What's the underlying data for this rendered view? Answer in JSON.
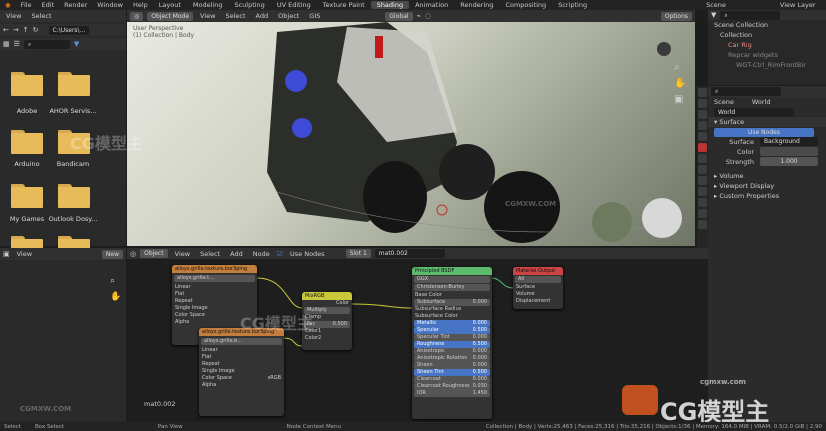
{
  "topbar": {
    "menus": [
      "File",
      "Edit",
      "Render",
      "Window",
      "Help"
    ],
    "workspaces": [
      "Layout",
      "Modeling",
      "Sculpting",
      "UV Editing",
      "Texture Paint",
      "Shading",
      "Animation",
      "Rendering",
      "Compositing",
      "Scripting"
    ],
    "active_workspace": "Shading",
    "scene_label": "Scene",
    "view_layer_label": "View Layer"
  },
  "file_browser": {
    "view_menu": "View",
    "select_menu": "Select",
    "path": "C:\\Users\\...",
    "items": [
      "Adobe",
      "AHOR Servis...",
      "Arduino",
      "Bandicam",
      "My Games",
      "Outlook Dosy..."
    ]
  },
  "viewport": {
    "mode": "Object Mode",
    "menus": [
      "View",
      "Select",
      "Add",
      "Object",
      "GIS"
    ],
    "transform": "Global",
    "options": "Options",
    "overlay_text": [
      "User Perspective",
      "(1) Collection | Body"
    ]
  },
  "outliner": {
    "title": "Scene Collection",
    "items": [
      "Collection",
      "Car Rig",
      "Repcar widgets",
      "WGT-Ctrl_RimFrontBir"
    ]
  },
  "properties": {
    "scene": "Scene",
    "world_tab": "World",
    "world_name": "World",
    "surface_header": "Surface",
    "use_nodes_btn": "Use Nodes",
    "surface_label": "Surface",
    "surface_value": "Background",
    "color_label": "Color",
    "strength_label": "Strength",
    "strength_value": "1.000",
    "sections": [
      "Volume",
      "Viewport Display",
      "Custom Properties"
    ]
  },
  "node_editor": {
    "object_select": "Object",
    "menus": [
      "View",
      "Select",
      "Add",
      "Node"
    ],
    "use_nodes": "Use Nodes",
    "slot": "Slot 1",
    "material": "mat0.002",
    "nodes": {
      "tex1": {
        "title": "alloys.grille.texture.bor3ping",
        "img": "alloys.grille.t...",
        "rows": [
          "Linear",
          "Flat",
          "Repeat",
          "Single Image",
          "Color Space",
          "Alpha"
        ]
      },
      "tex2": {
        "title": "alloys.grille.texture.bor3ping",
        "img": "alloys.grille.b...",
        "rows": [
          "Linear",
          "Flat",
          "Repeat",
          "Single Image",
          "Color Space",
          "Alpha"
        ],
        "space": "sRGB"
      },
      "mix": {
        "title": "MixRGB",
        "rows": [
          "Color",
          "Multiply",
          "Clamp",
          "Fac",
          "Color1",
          "Color2"
        ],
        "fac": "0.500"
      },
      "bsdf": {
        "title": "Principled BSDF",
        "rows": [
          "GGX",
          "Christensen-Burley",
          "Base Color",
          "Subsurface",
          "Subsurface Radius",
          "Subsurface Color",
          "Metallic",
          "Specular",
          "Specular Tint",
          "Roughness",
          "Anisotropic",
          "Anisotropic Rotation",
          "Sheen",
          "Sheen Tint",
          "Clearcoat",
          "Clearcoat Roughness",
          "IOR",
          "Transmission"
        ],
        "values": [
          "0.000",
          "0.000",
          "0.500",
          "0.000",
          "0.500",
          "0.000",
          "0.000",
          "0.000",
          "0.500",
          "0.000",
          "0.030",
          "1.450"
        ]
      },
      "out": {
        "title": "Material Output",
        "rows": [
          "All",
          "Surface",
          "Volume",
          "Displacement"
        ]
      }
    },
    "material_label": "mat0.002"
  },
  "left_panel": {
    "view": "View",
    "new_btn": "New"
  },
  "status": {
    "left": [
      "Select",
      "Box Select",
      "Pan View",
      "Node Context Menu"
    ],
    "right": "Collection | Body | Verts:25,463 | Faces:25,316 | Tris:35,216 | Objects:1/36 | Memory: 164.0 MiB | VRAM: 0.5/2.0 GiB | 2.90"
  },
  "watermarks": [
    "CGMXW.COM",
    "CG模型主",
    "cgmxw.com"
  ]
}
